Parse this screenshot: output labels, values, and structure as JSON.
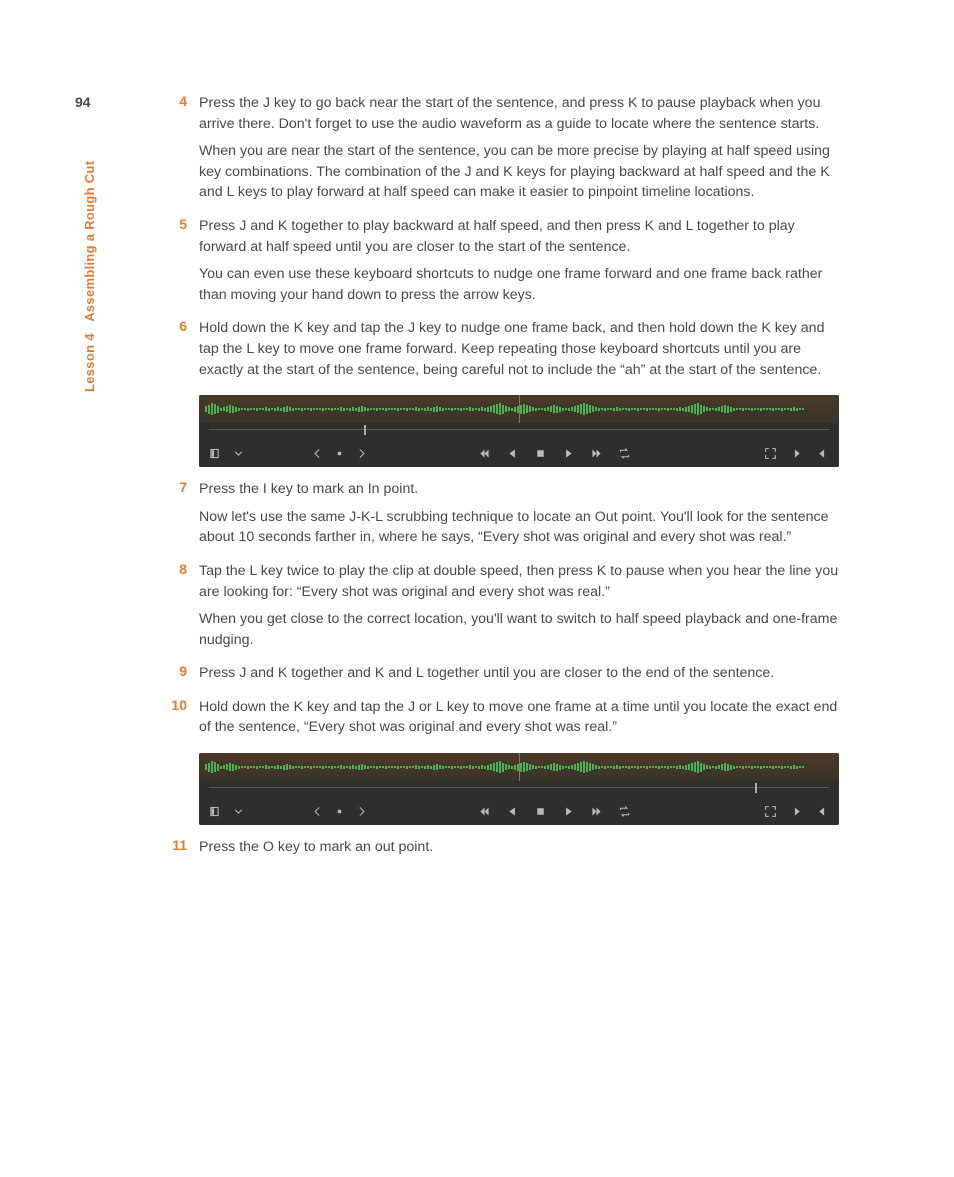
{
  "page_number": "94",
  "lesson": {
    "part1": "Lesson 4",
    "part2": "Assembling a Rough Cut"
  },
  "steps": [
    {
      "num": "4",
      "paras": [
        "Press the J key to go back near the start of the sentence, and press K to pause playback when you arrive there. Don't forget to use the audio waveform as a guide to locate where the sentence starts.",
        "When you are near the start of the sentence, you can be more precise by playing at half speed using key combinations. The combination of the J and K keys for playing backward at half speed and the K and L keys to play forward at half speed can make it easier to pinpoint timeline locations."
      ]
    },
    {
      "num": "5",
      "paras": [
        "Press J and K together to play backward at half speed, and then press K and L together to play forward at half speed until you are closer to the start of the sentence.",
        "You can even use these keyboard shortcuts to nudge one frame forward and one frame back rather than moving your hand down to press the arrow keys."
      ]
    },
    {
      "num": "6",
      "paras": [
        "Hold down the K key and tap the J key to nudge one frame back, and then hold down the K key and tap the L key to move one frame forward. Keep repeating those keyboard shortcuts until you are exactly at the start of the sentence, being careful not to include the “ah” at the start of the sentence."
      ],
      "screenshot": "a"
    },
    {
      "num": "7",
      "paras": [
        "Press the I key to mark an In point.",
        "Now let's use the same J-K-L scrubbing technique to locate an Out point. You'll look for the sentence about 10 seconds farther in, where he says, “Every shot was original and every shot was real.”"
      ]
    },
    {
      "num": "8",
      "paras": [
        "Tap the L key twice to play the clip at double speed, then press K to pause when you hear the line you are looking for: “Every shot was original and every shot was real.”",
        "When you get close to the correct location, you'll want to switch to half speed playback and one-frame nudging."
      ]
    },
    {
      "num": "9",
      "paras": [
        "Press J and K together and K and L together until you are closer to the end of the sentence."
      ]
    },
    {
      "num": "10",
      "paras": [
        "Hold down the K key and tap the J or L key to move one frame at a time until you locate the exact end of the sentence, “Every shot was original and every shot was real.”"
      ],
      "screenshot": "b"
    },
    {
      "num": "11",
      "paras": [
        "Press the O key to mark an out point."
      ]
    }
  ],
  "screenshots": {
    "a": {
      "playhead_pct": 50,
      "tick_pct": 25
    },
    "b": {
      "playhead_pct": 50,
      "tick_pct": 88
    }
  }
}
